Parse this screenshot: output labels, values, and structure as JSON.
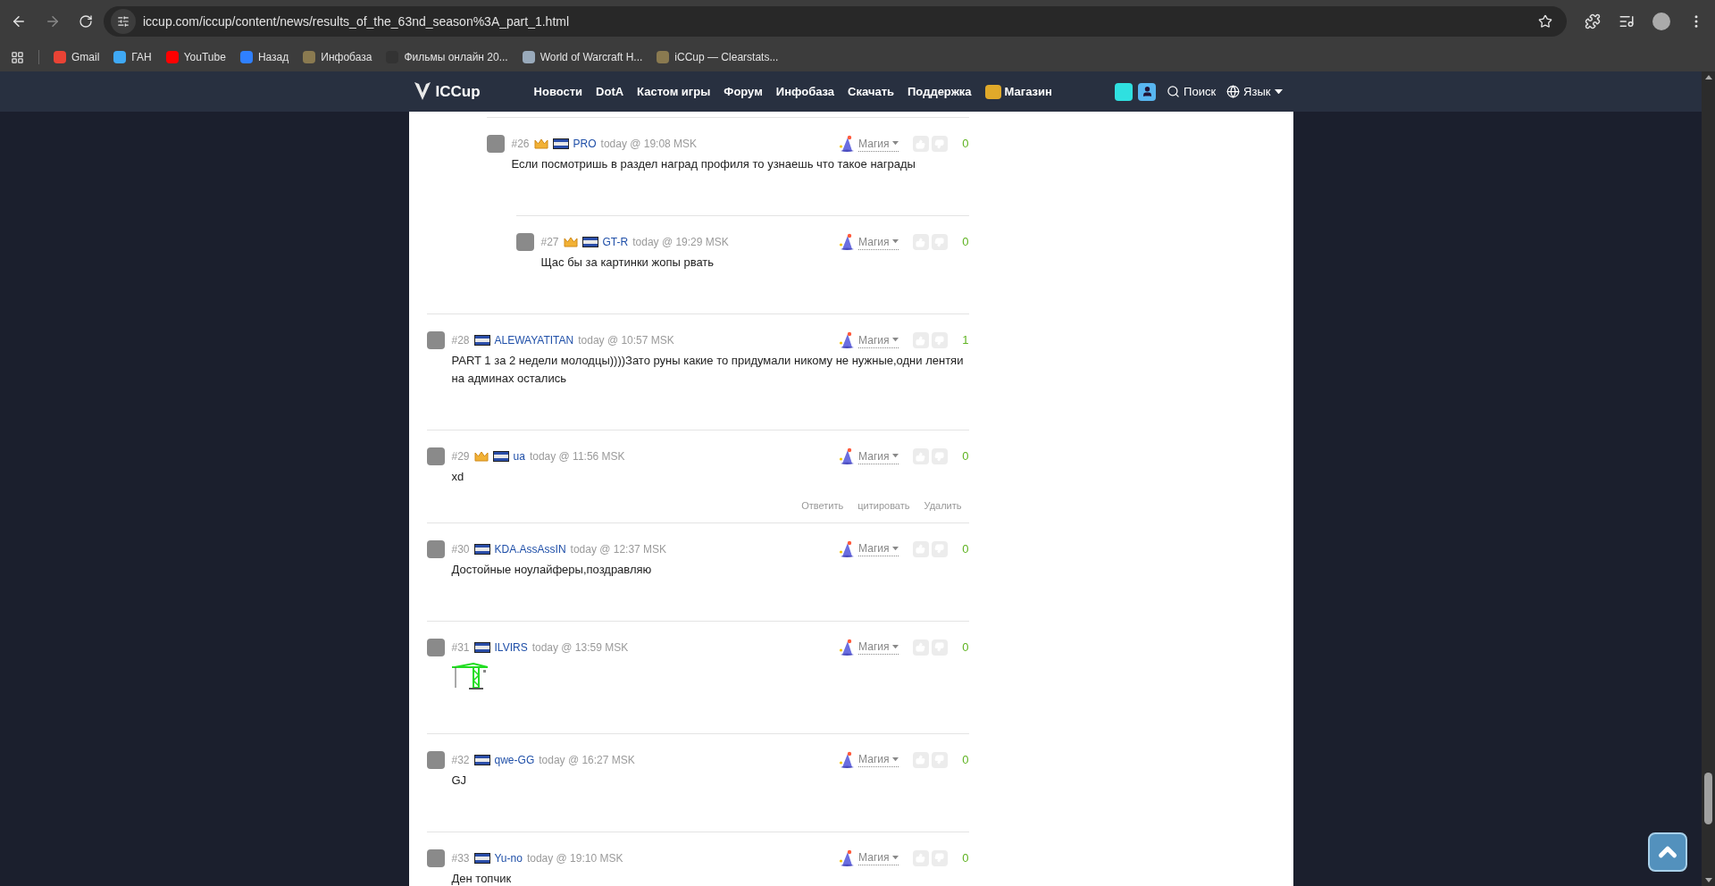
{
  "browser": {
    "url": "iccup.com/iccup/content/news/results_of_the_63nd_season%3A_part_1.html",
    "bookmarks": [
      "Gmail",
      "ГАН",
      "YouTube",
      "Назад",
      "Инфобаза",
      "Фильмы онлайн 20...",
      "World of Warcraft H...",
      "iCCup — Clearstats..."
    ]
  },
  "site_nav": {
    "logo": "ICCup",
    "items": [
      "Новости",
      "DotA",
      "Кастом игры",
      "Форум",
      "Инфобаза",
      "Скачать",
      "Поддержка",
      "Магазин"
    ],
    "search": "Поиск",
    "language": "Язык"
  },
  "thread_tail": [
    {
      "number": "#26",
      "crown": true,
      "name": "PRO",
      "time": "today @ 19:08 MSK",
      "kind": "text",
      "text": "Если посмотришь в раздел наград профиля то узнаешь что такое награды",
      "magic": "Магия",
      "score": "0",
      "children": [
        {
          "number": "#27",
          "crown": true,
          "name": "GT-R",
          "time": "today @ 19:29 MSK",
          "kind": "text",
          "text": "Щас бы за картинки жопы рвать",
          "magic": "Магия",
          "score": "0"
        }
      ]
    }
  ],
  "comments": [
    {
      "number": "#28",
      "crown": false,
      "name": "ALEWAYATITAN",
      "time": "today @ 10:57 MSK",
      "kind": "text",
      "text": "PART 1 за 2 недели молодцы))))Зато руны какие то придумали никому не нужные,одни лентяи на админах остались",
      "magic": "Магия",
      "score": "1"
    },
    {
      "number": "#29",
      "crown": true,
      "name": "ua",
      "time": "today @ 11:56 MSK",
      "kind": "text",
      "text": "xd",
      "magic": "Магия",
      "score": "0",
      "actions": [
        "Ответить",
        "цитировать",
        "Удалить"
      ]
    },
    {
      "number": "#30",
      "crown": false,
      "name": "KDA.AssAssIN",
      "time": "today @ 12:37 MSK",
      "kind": "text",
      "text": "Достойные ноулайферы,поздравляю",
      "magic": "Магия",
      "score": "0"
    },
    {
      "number": "#31",
      "crown": false,
      "name": "ILVIRS",
      "time": "today @ 13:59 MSK",
      "kind": "image",
      "magic": "Магия",
      "score": "0"
    },
    {
      "number": "#32",
      "crown": false,
      "name": "qwe-GG",
      "time": "today @ 16:27 MSK",
      "kind": "text",
      "text": "GJ",
      "magic": "Магия",
      "score": "0"
    },
    {
      "number": "#33",
      "crown": false,
      "name": "Yu-no",
      "time": "today @ 19:10 MSK",
      "kind": "text",
      "text": "Ден топчик",
      "magic": "Магия",
      "score": "0"
    }
  ]
}
